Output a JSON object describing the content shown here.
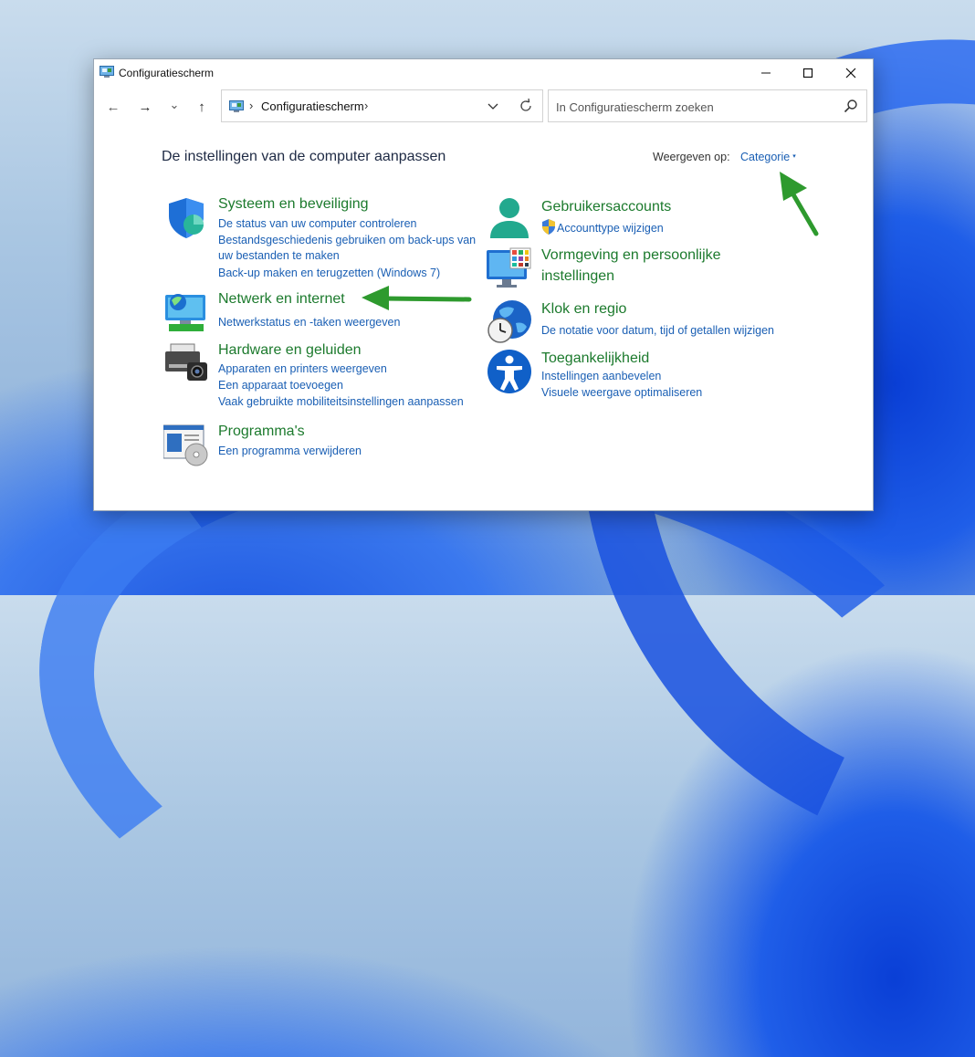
{
  "window": {
    "title": "Configuratiescherm",
    "minimize_glyph": "—",
    "maximize_glyph": "☐",
    "close_glyph": "✕"
  },
  "toolbar": {
    "back_glyph": "←",
    "forward_glyph": "→",
    "recent_glyph": "⌄",
    "up_glyph": "↑",
    "address_sep": "›",
    "address_path": "Configuratiescherm",
    "search_placeholder": "In Configuratiescherm zoeken"
  },
  "main": {
    "heading": "De instellingen van de computer aanpassen",
    "view_by_label": "Weergeven op:",
    "view_by_value": "Categorie",
    "view_by_caret": "▾"
  },
  "categories": {
    "system": {
      "title": "Systeem en beveiliging",
      "links": [
        "De status van uw computer controleren",
        "Bestandsgeschiedenis gebruiken om back-ups van",
        "uw bestanden te maken",
        "Back-up maken en terugzetten (Windows 7)"
      ]
    },
    "network": {
      "title": "Netwerk en internet",
      "links": [
        "Netwerkstatus en -taken weergeven"
      ]
    },
    "hardware": {
      "title": "Hardware en geluiden",
      "links": [
        "Apparaten en printers weergeven",
        "Een apparaat toevoegen",
        "Vaak gebruikte mobiliteitsinstellingen aanpassen"
      ]
    },
    "programs": {
      "title": "Programma's",
      "links": [
        "Een programma verwijderen"
      ]
    },
    "users": {
      "title": "Gebruikersaccounts",
      "links": [
        "Accounttype wijzigen"
      ]
    },
    "appearance": {
      "title_line1": "Vormgeving en persoonlijke",
      "title_line2": "instellingen"
    },
    "clock": {
      "title": "Klok en regio",
      "links": [
        "De notatie voor datum, tijd of getallen wijzigen"
      ]
    },
    "access": {
      "title": "Toegankelijkheid",
      "links": [
        "Instellingen aanbevelen",
        "Visuele weergave optimaliseren"
      ]
    }
  },
  "colors": {
    "category_title": "#1c7a2d",
    "link": "#1a5fb4",
    "annotation_arrow": "#2e9a2e"
  },
  "icons": [
    "control-panel-icon",
    "shield-icon",
    "network-icon",
    "printer-icon",
    "programs-icon",
    "user-icon",
    "uac-shield-icon",
    "appearance-icon",
    "clock-globe-icon",
    "accessibility-icon",
    "search-icon",
    "refresh-icon"
  ]
}
